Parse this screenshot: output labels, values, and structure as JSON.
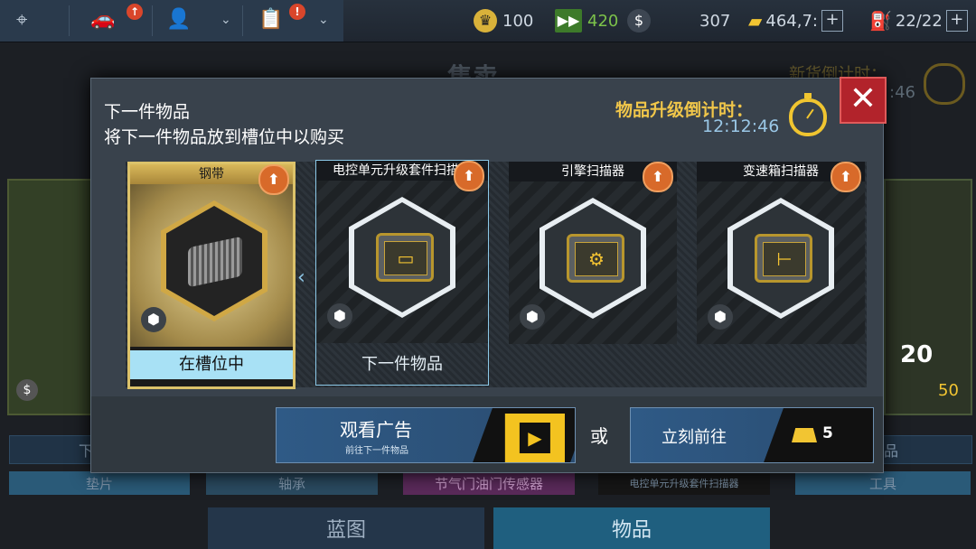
{
  "topbar": {
    "nav_badges": [
      "↑",
      "↑",
      "!"
    ],
    "crowns": "100",
    "tickets": "420",
    "cash": "307",
    "gold": "464,7:",
    "fuel": "22/22",
    "plus": "+"
  },
  "background": {
    "title": "售卖",
    "countdown_label": "新货倒计时：",
    "countdown_partial": ":46",
    "left_tab": "下一件",
    "right_tab": "物品",
    "labels": [
      "垫片",
      "轴承",
      "节气门油门传感器",
      "电控单元升级套件扫描器",
      "工具"
    ],
    "left_cost": "$",
    "right_count": "20",
    "right_price": "50",
    "bottom_tabs": [
      "蓝图",
      "物品"
    ]
  },
  "dialog": {
    "title": "下一件物品",
    "subtitle": "将下一件物品放到槽位中以购买",
    "upgrade_label": "物品升级倒计时：",
    "upgrade_time": "12:12:46",
    "close": "✕",
    "cards": [
      {
        "name": "钢带",
        "status": "在槽位中",
        "icon": "steel-belt"
      },
      {
        "name": "电控单元升级套件扫描器",
        "status": "下一件物品",
        "icon": "ecu-scanner"
      },
      {
        "name": "引擎扫描器",
        "status": "",
        "icon": "engine-scanner"
      },
      {
        "name": "变速箱扫描器",
        "status": "",
        "icon": "gearbox-scanner"
      }
    ],
    "watch_ad": {
      "label": "观看广告",
      "sub": "前往下一件物品"
    },
    "or": "或",
    "go_now": {
      "label": "立刻前往",
      "cost": "5"
    }
  },
  "colors": {
    "accent_gold": "#f0c64a",
    "timer_blue": "#9ac7e6",
    "close_red": "#b2232b",
    "slot_highlight": "#a8e1f5"
  }
}
